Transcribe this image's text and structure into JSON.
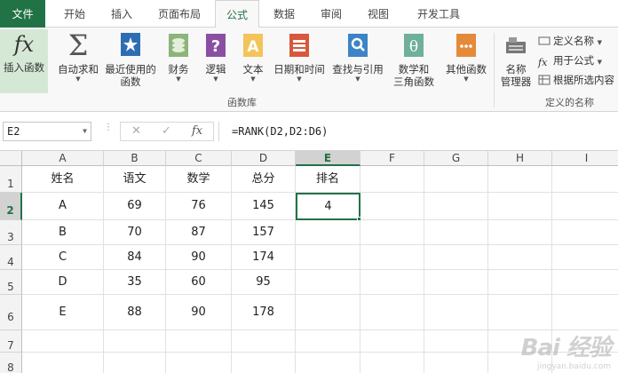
{
  "tabs": [
    {
      "label": "文件",
      "active": false,
      "file": true
    },
    {
      "label": "开始",
      "active": false
    },
    {
      "label": "插入",
      "active": false
    },
    {
      "label": "页面布局",
      "active": false
    },
    {
      "label": "公式",
      "active": true
    },
    {
      "label": "数据",
      "active": false
    },
    {
      "label": "审阅",
      "active": false
    },
    {
      "label": "视图",
      "active": false
    },
    {
      "label": "开发工具",
      "active": false
    }
  ],
  "ribbon": {
    "insert_function": "插入函数",
    "autosum": "自动求和",
    "recent": "最近使用的\n函数",
    "financial": "财务",
    "logical": "逻辑",
    "text": "文本",
    "datetime": "日期和时间",
    "lookup": "查找与引用",
    "math": "数学和\n三角函数",
    "more": "其他函数",
    "name_manager": "名称\n管理器",
    "define_name": "定义名称",
    "use_in_formula": "用于公式",
    "create_from_selection": "根据所选内容",
    "group_function_library": "函数库",
    "group_defined_names": "定义的名称"
  },
  "formula_bar": {
    "name_box": "E2",
    "cancel": "✕",
    "enter": "✓",
    "fx": "fx",
    "formula": "=RANK(D2,D2:D6)"
  },
  "sheet": {
    "columns": [
      "A",
      "B",
      "C",
      "D",
      "E",
      "F",
      "G",
      "H",
      "I"
    ],
    "rows": [
      "1",
      "2",
      "3",
      "4",
      "5",
      "6",
      "7",
      "8"
    ],
    "cells": [
      [
        "姓名",
        "语文",
        "数学",
        "总分",
        "排名"
      ],
      [
        "A",
        "69",
        "76",
        "145",
        "4"
      ],
      [
        "B",
        "70",
        "87",
        "157",
        ""
      ],
      [
        "C",
        "84",
        "90",
        "174",
        ""
      ],
      [
        "D",
        "35",
        "60",
        "95",
        ""
      ],
      [
        "E",
        "88",
        "90",
        "178",
        ""
      ],
      [
        "",
        "",
        "",
        "",
        ""
      ],
      [
        "",
        "",
        "",
        "",
        ""
      ]
    ],
    "active_cell": "E2"
  },
  "watermark": {
    "main": "Bai 经验",
    "sub": "jingyan.baidu.com"
  }
}
